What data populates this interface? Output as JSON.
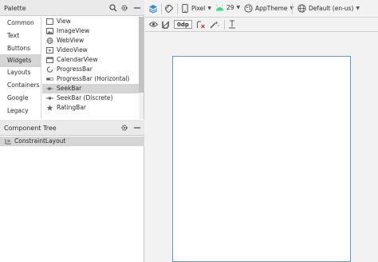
{
  "palette": {
    "title": "Palette",
    "categories": [
      "Common",
      "Text",
      "Buttons",
      "Widgets",
      "Layouts",
      "Containers",
      "Google",
      "Legacy"
    ],
    "selected_category": "Widgets",
    "widgets": [
      {
        "label": "View",
        "icon": "view-icon"
      },
      {
        "label": "ImageView",
        "icon": "image-icon"
      },
      {
        "label": "WebView",
        "icon": "web-icon"
      },
      {
        "label": "VideoView",
        "icon": "video-icon"
      },
      {
        "label": "CalendarView",
        "icon": "calendar-icon"
      },
      {
        "label": "ProgressBar",
        "icon": "progress-circle-icon"
      },
      {
        "label": "ProgressBar (Horizontal)",
        "icon": "progress-bar-icon"
      },
      {
        "label": "SeekBar",
        "icon": "seekbar-icon"
      },
      {
        "label": "SeekBar (Discrete)",
        "icon": "seekbar-discrete-icon"
      },
      {
        "label": "RatingBar",
        "icon": "star-icon"
      }
    ],
    "selected_widget": "SeekBar"
  },
  "component_tree": {
    "title": "Component Tree",
    "root": "ConstraintLayout"
  },
  "toolbar": {
    "device": "Pixel",
    "api_level": "29",
    "theme": "AppTheme",
    "locale": "Default (en-us)",
    "margin": "0dp"
  },
  "colors": {
    "accent": "#5b9bd5",
    "android_green": "#3ddc84",
    "selection": "#d5d5d5"
  }
}
